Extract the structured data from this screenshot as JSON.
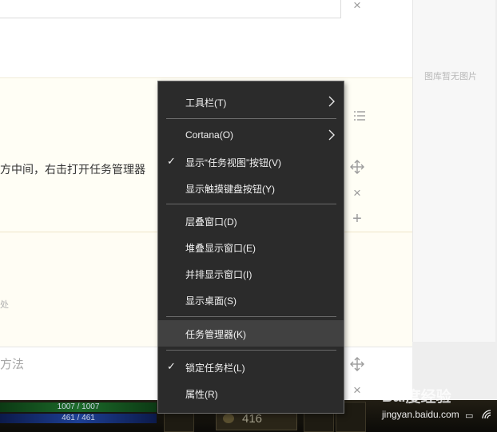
{
  "gallery": {
    "empty_text": "图库暂无图片"
  },
  "steps": {
    "step1_text": "方中间，右击打开任务管理器",
    "step2_text": "处",
    "step3_text": "方法"
  },
  "context_menu": {
    "items": [
      {
        "label": "工具栏(T)"
      },
      {
        "label": "Cortana(O)"
      },
      {
        "label": "显示“任务视图”按钮(V)"
      },
      {
        "label": "显示触摸键盘按钮(Y)"
      },
      {
        "label": "层叠窗口(D)"
      },
      {
        "label": "堆叠显示窗口(E)"
      },
      {
        "label": "并排显示窗口(I)"
      },
      {
        "label": "显示桌面(S)"
      },
      {
        "label": "任务管理器(K)"
      },
      {
        "label": "锁定任务栏(L)"
      },
      {
        "label": "属性(R)"
      }
    ],
    "checked": [
      "显示“任务视图”按钮(V)",
      "锁定任务栏(L)"
    ],
    "highlighted": "任务管理器(K)"
  },
  "game": {
    "hp_text": "1007 / 1007",
    "mp_text": "461 / 461",
    "gold": "416"
  },
  "watermark": {
    "logo": "Bai度经验",
    "url": "jingyan.baidu.com"
  },
  "icons": {
    "toolbar": [
      "close-icon",
      "list-icon",
      "move-icon",
      "close-icon",
      "add-icon",
      "move-icon",
      "close-icon"
    ]
  },
  "colors": {
    "menu_bg": "#2b2b2b",
    "menu_highlight": "#414141",
    "menu_text": "#f2f2f2",
    "step_bg": "#fffef5"
  }
}
